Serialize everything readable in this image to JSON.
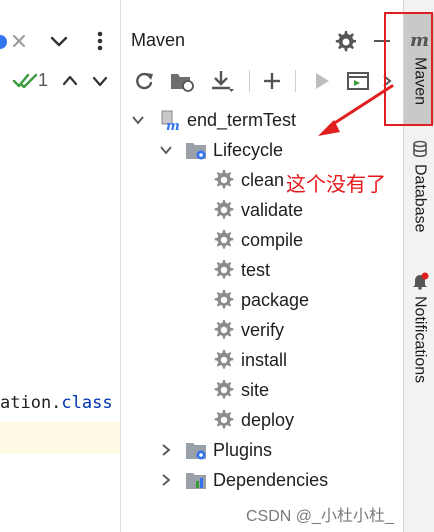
{
  "editor": {
    "counter": "1",
    "code_text": "ation.",
    "code_class": "class"
  },
  "maven_panel": {
    "title": "Maven",
    "tree": {
      "root": "end_termTest",
      "lifecycle": "Lifecycle",
      "phases": [
        "clean",
        "validate",
        "compile",
        "test",
        "package",
        "verify",
        "install",
        "site",
        "deploy"
      ],
      "plugins": "Plugins",
      "dependencies": "Dependencies"
    }
  },
  "tool_windows": {
    "maven": "Maven",
    "database": "Database",
    "notifications": "Notifications"
  },
  "annotation": {
    "text": "这个没有了",
    "color": "#e8171c"
  },
  "watermark": "CSDN @_小杜小杜_",
  "colors": {
    "accent_blue": "#3574f0",
    "gear_grey": "#8c8c8c",
    "red": "#e02020"
  }
}
